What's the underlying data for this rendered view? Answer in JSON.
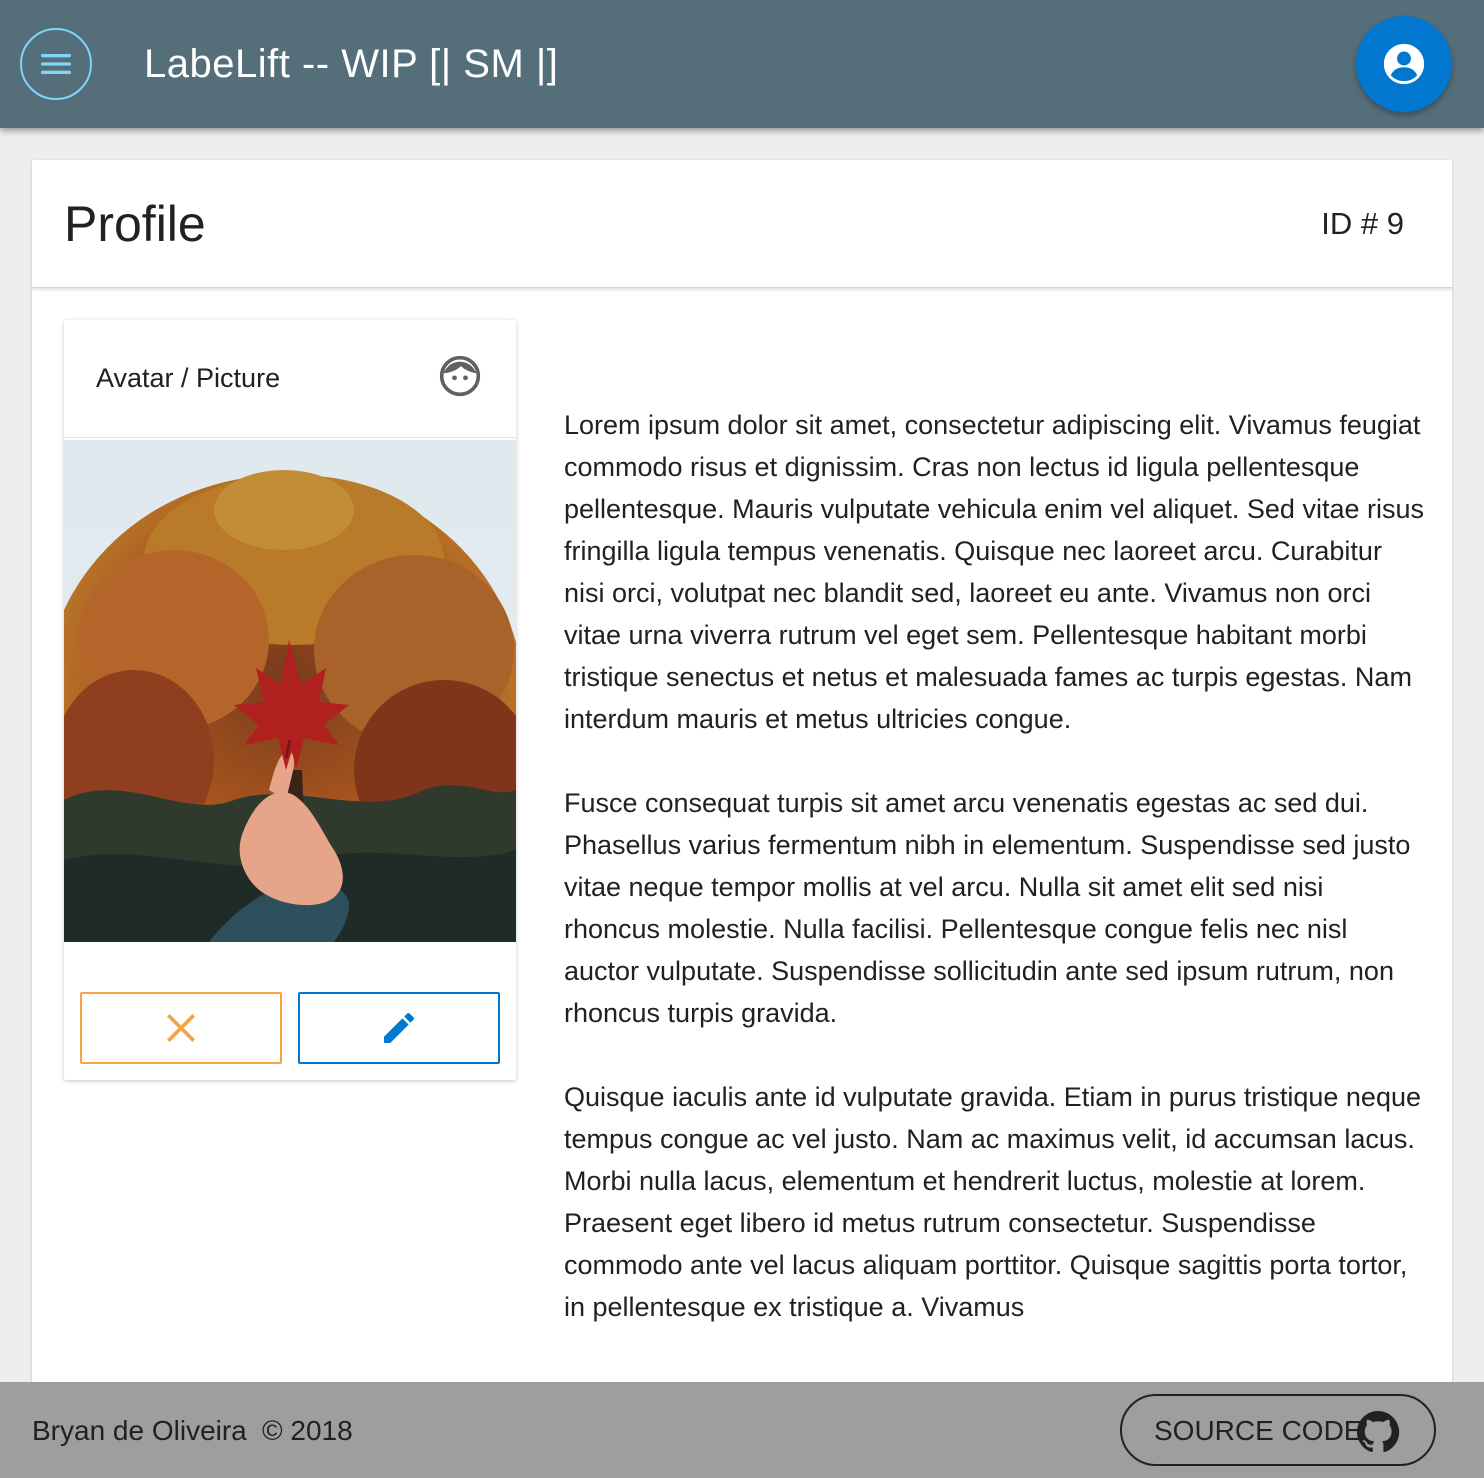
{
  "appbar": {
    "title": "LabeLift -- WIP [| SM |]",
    "menu_icon": "menu-icon",
    "account_icon": "account-circle-icon",
    "accent_color": "#546e7a"
  },
  "profile": {
    "title": "Profile",
    "id_label": "ID # 9"
  },
  "avatar_card": {
    "title": "Avatar / Picture",
    "title_icon": "face-icon",
    "remove_icon": "close-icon",
    "edit_icon": "pencil-icon",
    "remove_color": "#f7a245",
    "edit_color": "#0277d0"
  },
  "bio": {
    "paragraphs": [
      "Lorem ipsum dolor sit amet, consectetur adipiscing elit. Vivamus feugiat commodo risus et dignissim. Cras non lectus id ligula pellentesque pellentesque. Mauris vulputate vehicula enim vel aliquet. Sed vitae risus fringilla ligula tempus venenatis. Quisque nec laoreet arcu. Curabitur nisi orci, volutpat nec blandit sed, laoreet eu ante. Vivamus non orci vitae urna viverra rutrum vel eget sem. Pellentesque habitant morbi tristique senectus et netus et malesuada fames ac turpis egestas. Nam interdum mauris et metus ultricies congue.",
      "Fusce consequat turpis sit amet arcu venenatis egestas ac sed dui. Phasellus varius fermentum nibh in elementum. Suspendisse sed justo vitae neque tempor mollis at vel arcu. Nulla sit amet elit sed nisi rhoncus molestie. Nulla facilisi. Pellentesque congue felis nec nisl auctor vulputate. Suspendisse sollicitudin ante sed ipsum rutrum, non rhoncus turpis gravida.",
      "Quisque iaculis ante id vulputate gravida. Etiam in purus tristique neque tempus congue ac vel justo. Nam ac maximus velit, id accumsan lacus. Morbi nulla lacus, elementum et hendrerit luctus, molestie at lorem. Praesent eget libero id metus rutrum consectetur. Suspendisse commodo ante vel lacus aliquam porttitor. Quisque sagittis porta tortor, in pellentesque ex tristique a. Vivamus"
    ]
  },
  "footer": {
    "author": "Bryan de Oliveira",
    "copyright": "© 2018",
    "source_label": "SOURCE CODE",
    "source_icon": "github-icon"
  }
}
